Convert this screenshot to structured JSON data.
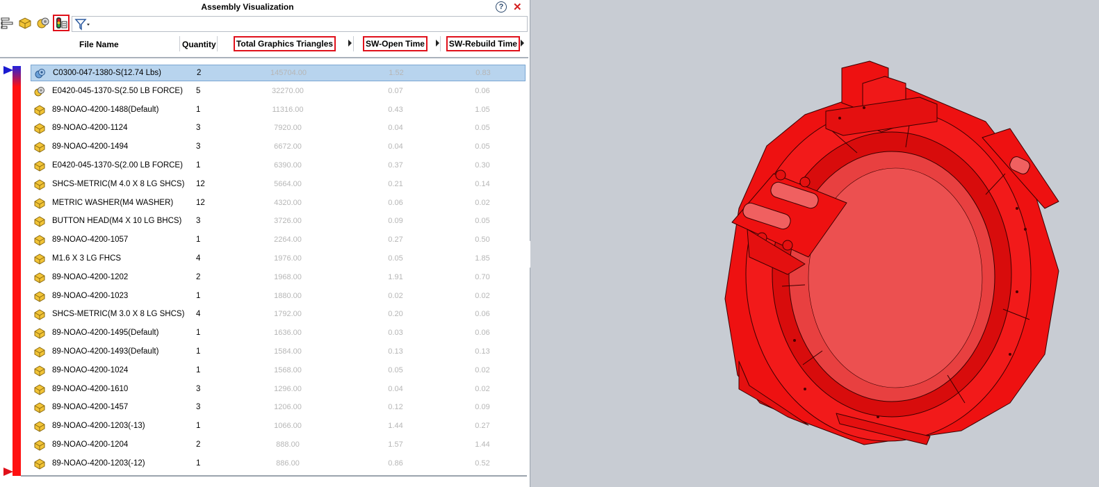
{
  "panel": {
    "title": "Assembly Visualization",
    "help_icon": "help-icon",
    "close_icon": "close-icon"
  },
  "toolbar": {
    "buttons": [
      {
        "name": "tree-view-icon"
      },
      {
        "name": "part-icon"
      },
      {
        "name": "assembly-icon"
      },
      {
        "name": "color-property-icon",
        "highlighted": true
      },
      {
        "name": "filter-icon"
      }
    ],
    "filter_value": ""
  },
  "columns": {
    "file_name": "File Name",
    "quantity": "Quantity",
    "triangles": "Total Graphics Triangles",
    "open_time": "SW-Open Time",
    "rebuild_time": "SW-Rebuild Time"
  },
  "rows": [
    {
      "name": "C0300-047-1380-S(12.74 Lbs)",
      "qty": "2",
      "triangles": "145704.00",
      "open": "1.52",
      "rebuild": "0.83",
      "type": "assembly",
      "selected": true
    },
    {
      "name": "E0420-045-1370-S(2.50 LB FORCE)",
      "qty": "5",
      "triangles": "32270.00",
      "open": "0.07",
      "rebuild": "0.06",
      "type": "assembly"
    },
    {
      "name": "89-NOAO-4200-1488(Default)",
      "qty": "1",
      "triangles": "11316.00",
      "open": "0.43",
      "rebuild": "1.05",
      "type": "part"
    },
    {
      "name": "89-NOAO-4200-1124",
      "qty": "3",
      "triangles": "7920.00",
      "open": "0.04",
      "rebuild": "0.05",
      "type": "part"
    },
    {
      "name": "89-NOAO-4200-1494",
      "qty": "3",
      "triangles": "6672.00",
      "open": "0.04",
      "rebuild": "0.05",
      "type": "part"
    },
    {
      "name": "E0420-045-1370-S(2.00 LB FORCE)",
      "qty": "1",
      "triangles": "6390.00",
      "open": "0.37",
      "rebuild": "0.30",
      "type": "part"
    },
    {
      "name": "SHCS-METRIC(M 4.0 X 8 LG SHCS)",
      "qty": "12",
      "triangles": "5664.00",
      "open": "0.21",
      "rebuild": "0.14",
      "type": "part"
    },
    {
      "name": "METRIC WASHER(M4 WASHER)",
      "qty": "12",
      "triangles": "4320.00",
      "open": "0.06",
      "rebuild": "0.02",
      "type": "part"
    },
    {
      "name": "BUTTON HEAD(M4 X 10 LG BHCS)",
      "qty": "3",
      "triangles": "3726.00",
      "open": "0.09",
      "rebuild": "0.05",
      "type": "part"
    },
    {
      "name": "89-NOAO-4200-1057",
      "qty": "1",
      "triangles": "2264.00",
      "open": "0.27",
      "rebuild": "0.50",
      "type": "part"
    },
    {
      "name": "M1.6 X 3 LG FHCS",
      "qty": "4",
      "triangles": "1976.00",
      "open": "0.05",
      "rebuild": "1.85",
      "type": "part"
    },
    {
      "name": "89-NOAO-4200-1202",
      "qty": "2",
      "triangles": "1968.00",
      "open": "1.91",
      "rebuild": "0.70",
      "type": "part"
    },
    {
      "name": "89-NOAO-4200-1023",
      "qty": "1",
      "triangles": "1880.00",
      "open": "0.02",
      "rebuild": "0.02",
      "type": "part"
    },
    {
      "name": "SHCS-METRIC(M 3.0  X 8 LG SHCS)",
      "qty": "4",
      "triangles": "1792.00",
      "open": "0.20",
      "rebuild": "0.06",
      "type": "part"
    },
    {
      "name": "89-NOAO-4200-1495(Default)",
      "qty": "1",
      "triangles": "1636.00",
      "open": "0.03",
      "rebuild": "0.06",
      "type": "part"
    },
    {
      "name": "89-NOAO-4200-1493(Default)",
      "qty": "1",
      "triangles": "1584.00",
      "open": "0.13",
      "rebuild": "0.13",
      "type": "part"
    },
    {
      "name": "89-NOAO-4200-1024",
      "qty": "1",
      "triangles": "1568.00",
      "open": "0.05",
      "rebuild": "0.02",
      "type": "part"
    },
    {
      "name": "89-NOAO-4200-1610",
      "qty": "3",
      "triangles": "1296.00",
      "open": "0.04",
      "rebuild": "0.02",
      "type": "part"
    },
    {
      "name": "89-NOAO-4200-1457",
      "qty": "3",
      "triangles": "1206.00",
      "open": "0.12",
      "rebuild": "0.09",
      "type": "part"
    },
    {
      "name": "89-NOAO-4200-1203(-13)",
      "qty": "1",
      "triangles": "1066.00",
      "open": "1.44",
      "rebuild": "0.27",
      "type": "part"
    },
    {
      "name": "89-NOAO-4200-1204",
      "qty": "2",
      "triangles": "888.00",
      "open": "1.57",
      "rebuild": "1.44",
      "type": "part"
    },
    {
      "name": "89-NOAO-4200-1203(-12)",
      "qty": "1",
      "triangles": "886.00",
      "open": "0.86",
      "rebuild": "0.52",
      "type": "part"
    }
  ],
  "colors": {
    "highlight": "#e0101a",
    "selection": "#b8d4ee",
    "model": "#ee1111",
    "viewport_bg": "#c8ccd3",
    "slider_top": "#1a1ad0"
  }
}
